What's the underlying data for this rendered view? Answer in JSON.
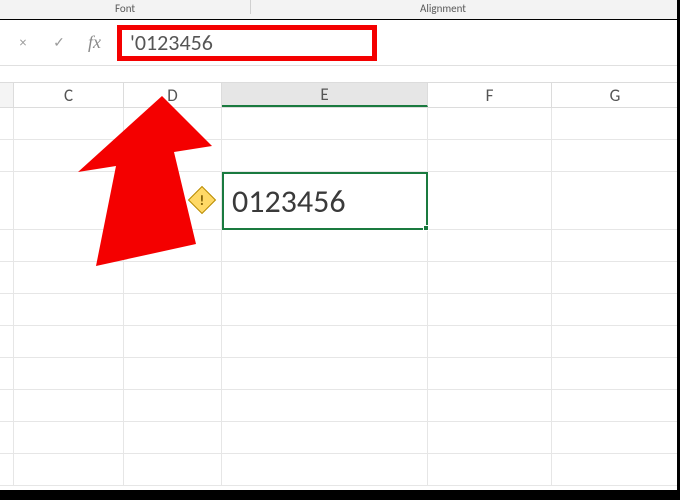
{
  "ribbon": {
    "font_label": "Font",
    "alignment_label": "Alignment"
  },
  "formula_bar": {
    "cancel": "×",
    "enter": "✓",
    "fx_label": "fx",
    "content": "'0123456"
  },
  "columns": {
    "c": "C",
    "d": "D",
    "e": "E",
    "f": "F",
    "g": "G"
  },
  "cell": {
    "value": "0123456"
  },
  "error_indicator": {
    "glyph": "!"
  },
  "annotation": {
    "arrow_color": "#f40000"
  }
}
